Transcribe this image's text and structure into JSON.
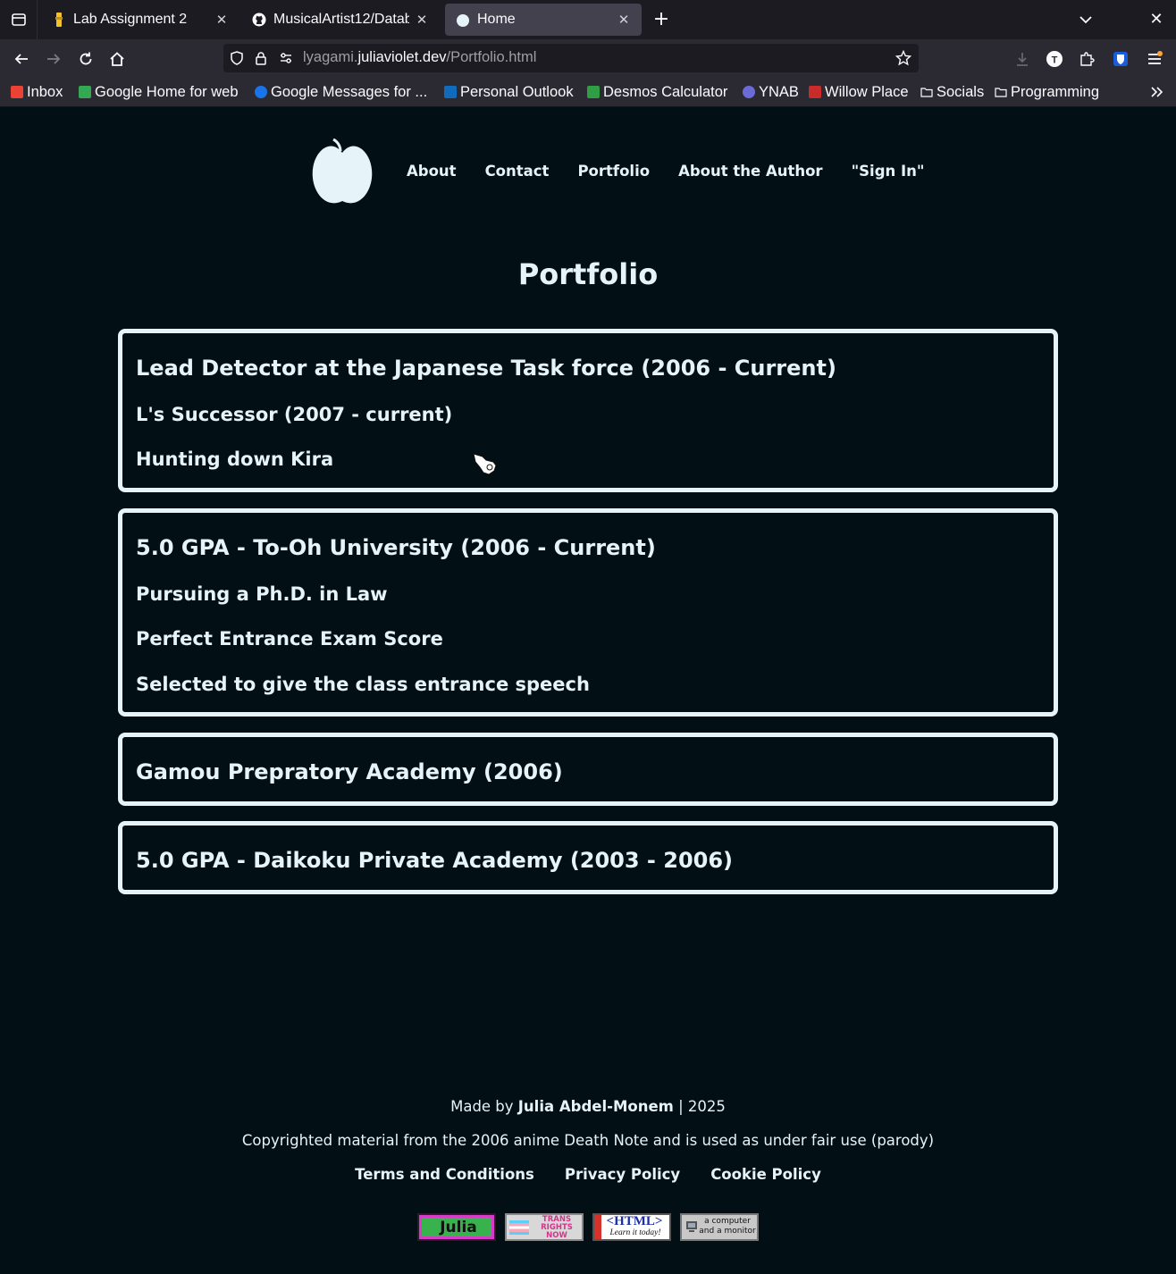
{
  "browser": {
    "tabs": [
      {
        "title": "Lab Assignment 2",
        "active": false
      },
      {
        "title": "MusicalArtist12/Datab",
        "active": false
      },
      {
        "title": "Home",
        "active": true
      }
    ],
    "url_prefix": "lyagami.",
    "url_domain": "juliaviolet.dev",
    "url_path": "/Portfolio.html",
    "bookmarks": [
      {
        "label": "Inbox",
        "icon_color": "#ea4335"
      },
      {
        "label": "Google Home for web",
        "icon_color": "#34a853"
      },
      {
        "label": "Google Messages for ...",
        "icon_color": "#1a73e8"
      },
      {
        "label": "Personal Outlook",
        "icon_color": "#0f6cbd"
      },
      {
        "label": "Desmos Calculator",
        "icon_color": "#2f9e44"
      },
      {
        "label": "YNAB",
        "icon_color": "#6b6bd6"
      },
      {
        "label": "Willow Place",
        "icon_color": "#c92a2a"
      },
      {
        "label": "Socials",
        "icon": "folder-icon"
      },
      {
        "label": "Programming",
        "icon": "folder-icon"
      }
    ]
  },
  "site": {
    "nav": [
      "About",
      "Contact",
      "Portfolio",
      "About the Author",
      "\"Sign In\""
    ],
    "title": "Portfolio",
    "cards": [
      {
        "heading": "Lead Detector at the Japanese Task force (2006 - Current)",
        "items": [
          "L's Successor (2007 - current)",
          "Hunting down Kira"
        ]
      },
      {
        "heading": "5.0 GPA - To-Oh University (2006 - Current)",
        "items": [
          "Pursuing a Ph.D. in Law",
          "Perfect Entrance Exam Score",
          "Selected to give the class entrance speech"
        ]
      },
      {
        "heading": "Gamou Prepratory Academy (2006)",
        "items": []
      },
      {
        "heading": "5.0 GPA - Daikoku Private Academy (2003 - 2006)",
        "items": []
      }
    ],
    "footer": {
      "made_by_prefix": "Made by ",
      "author": "Julia Abdel-Monem",
      "year_suffix": " | 2025",
      "copyright": "Copyrighted material from the 2006 anime Death Note and is used as under fair use (parody)",
      "legal": [
        "Terms and Conditions",
        "Privacy Policy",
        "Cookie Policy"
      ],
      "badges": [
        {
          "text": "Julia"
        },
        {
          "text": "TRANS RIGHTS NOW"
        },
        {
          "text": "<HTML>",
          "sub": "Learn it today!"
        },
        {
          "text": "a computer and a monitor"
        }
      ]
    }
  },
  "colors": {
    "page_bg": "#020f14",
    "foreground": "#e6f3f8",
    "chrome_dark": "#1c1b22",
    "chrome_mid": "#2b2a33",
    "tab_active": "#42414d"
  }
}
